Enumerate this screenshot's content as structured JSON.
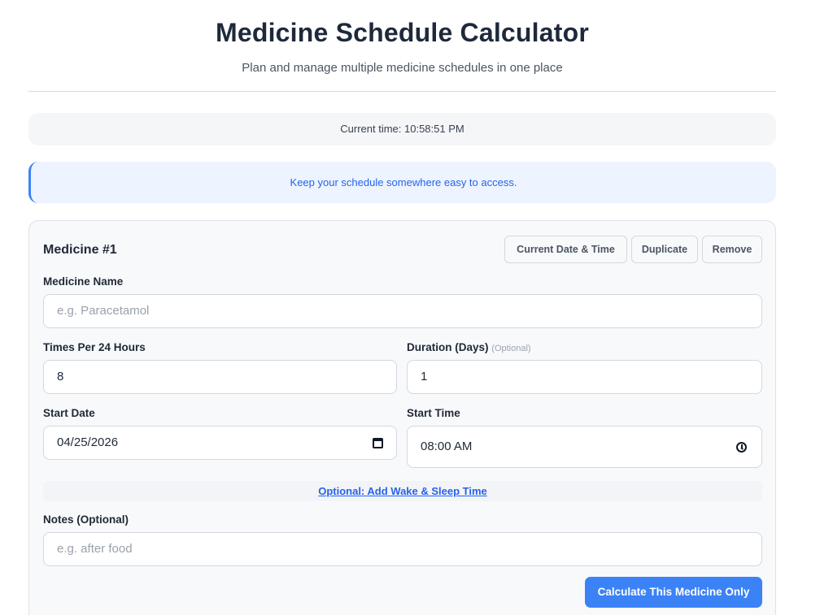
{
  "header": {
    "title": "Medicine Schedule Calculator",
    "subtitle": "Plan and manage multiple medicine schedules in one place"
  },
  "time_bar": {
    "text": "Current time: 10:58:51 PM"
  },
  "info_banner": {
    "text": "Keep your schedule somewhere easy to access."
  },
  "medicine_card": {
    "title": "Medicine #1",
    "buttons": {
      "current_date_time": "Current Date & Time",
      "duplicate": "Duplicate",
      "remove": "Remove"
    },
    "name": {
      "label": "Medicine Name",
      "value": "",
      "placeholder": "e.g. Paracetamol"
    },
    "times_per_day": {
      "label": "Times Per 24 Hours",
      "value": "8"
    },
    "duration": {
      "label": "Duration (Days)",
      "optional": "(Optional)",
      "value": "1"
    },
    "start_date": {
      "label": "Start Date",
      "value": "04/25/2026",
      "icon": "calendar-icon"
    },
    "start_time": {
      "label": "Start Time",
      "value": "08:00 AM",
      "icon": "clock-icon"
    },
    "wake_sleep_link": "Optional: Add Wake & Sleep Time",
    "notes": {
      "label": "Notes (Optional)",
      "value": "",
      "placeholder": "e.g. after food"
    },
    "calculate_button": "Calculate This Medicine Only"
  },
  "colors": {
    "accent": "#3b82f6",
    "link": "#2563eb",
    "banner_bg": "#eef4ff",
    "card_bg": "#f8f9fb"
  }
}
